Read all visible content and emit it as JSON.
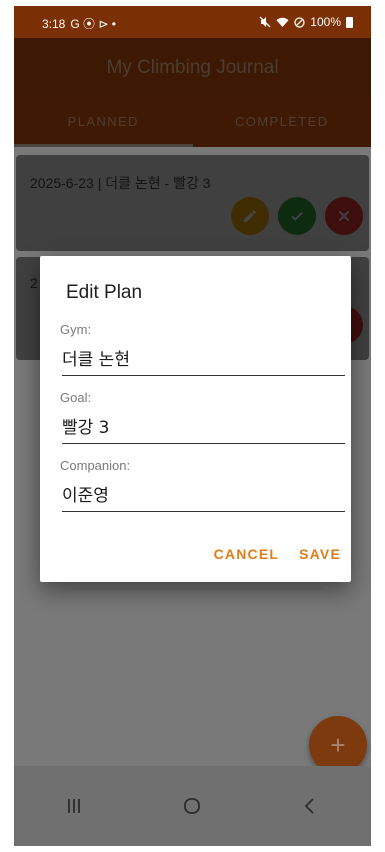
{
  "status_bar": {
    "time": "3:18",
    "indicators": "G ⦿ ⊳ •",
    "right_icons": "mute-vibrate, wifi, dnd",
    "battery": "100%"
  },
  "app": {
    "title": "My Climbing Journal"
  },
  "tabs": [
    {
      "label": "PLANNED",
      "active": true
    },
    {
      "label": "COMPLETED",
      "active": false
    }
  ],
  "plans": [
    {
      "text": "2025-6-23 | 더클 논현 - 빨강 3"
    },
    {
      "text": "2"
    }
  ],
  "dialog": {
    "title": "Edit Plan",
    "gym_label": "Gym:",
    "gym_value": "더클 논현",
    "goal_label": "Goal:",
    "goal_value": "빨강 3",
    "companion_label": "Companion:",
    "companion_value": "이준영",
    "cancel_label": "CANCEL",
    "save_label": "SAVE"
  },
  "fab": {
    "label": "+"
  },
  "colors": {
    "accent": "#e07d1a",
    "edit": "#f4a008",
    "done": "#2fab3e",
    "delete": "#e53838"
  },
  "icons": {
    "edit": "pencil-icon",
    "done": "check-icon",
    "delete": "close-icon",
    "nav_recents": "recents-icon",
    "nav_home": "home-icon",
    "nav_back": "back-icon"
  }
}
